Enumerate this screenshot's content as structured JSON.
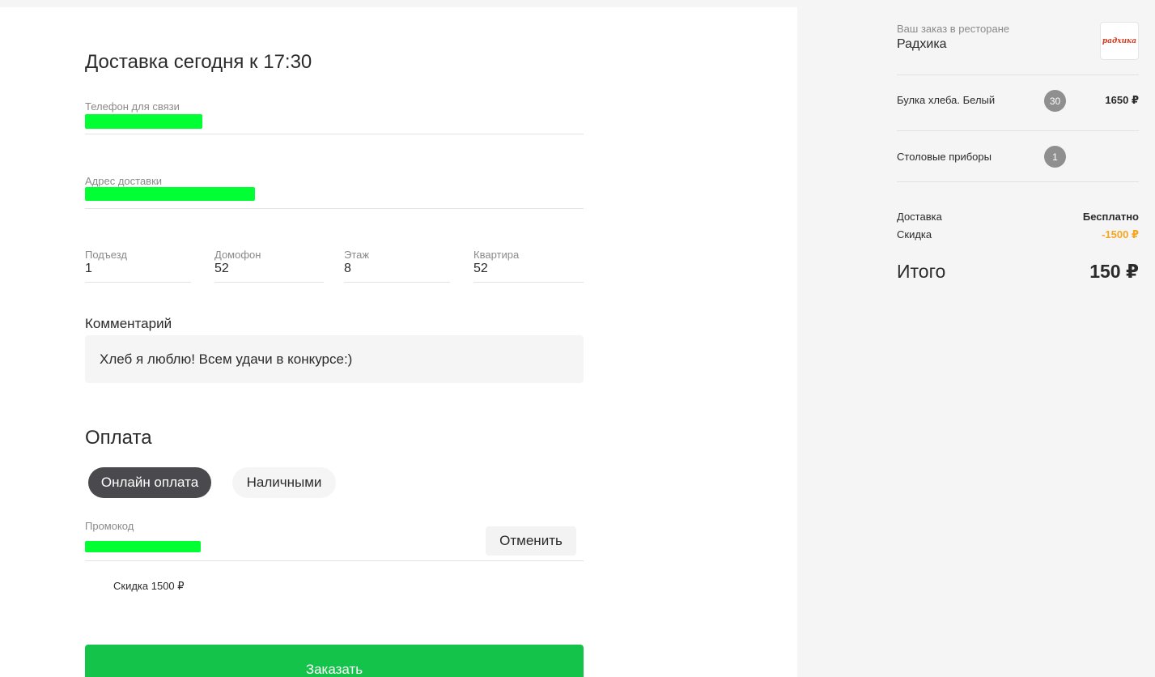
{
  "delivery": {
    "title": "Доставка сегодня к 17:30",
    "phone_label": "Телефон для связи",
    "address_label": "Адрес доставки",
    "entrance_label": "Подъезд",
    "entrance_value": "1",
    "intercom_label": "Домофон",
    "intercom_value": "52",
    "floor_label": "Этаж",
    "floor_value": "8",
    "apartment_label": "Квартира",
    "apartment_value": "52",
    "comment_label": "Комментарий",
    "comment_value": "Хлеб я люблю! Всем удачи в конкурсе:)"
  },
  "payment": {
    "title": "Оплата",
    "options": [
      "Онлайн оплата",
      "Наличными"
    ],
    "selected": "Онлайн оплата",
    "promo_label": "Промокод",
    "cancel_label": "Отменить",
    "discount_note": "Скидка 1500 ₽",
    "order_button": "Заказать"
  },
  "order": {
    "header_label": "Ваш заказ в ресторане",
    "restaurant_name": "Радхика",
    "logo_text": "радхика",
    "items": [
      {
        "name": "Булка хлеба. Белый",
        "qty": "30",
        "price": "1650 ₽"
      },
      {
        "name": "Столовые приборы",
        "qty": "1",
        "price": ""
      }
    ],
    "delivery_label": "Доставка",
    "delivery_value": "Бесплатно",
    "discount_label": "Скидка",
    "discount_value": "-1500 ₽",
    "total_label": "Итого",
    "total_value": "150 ₽"
  },
  "colors": {
    "accent_green": "#14c44a",
    "discount_orange": "#f5a623",
    "active_pill": "#4a4a4e",
    "redaction": "#00ff33"
  }
}
